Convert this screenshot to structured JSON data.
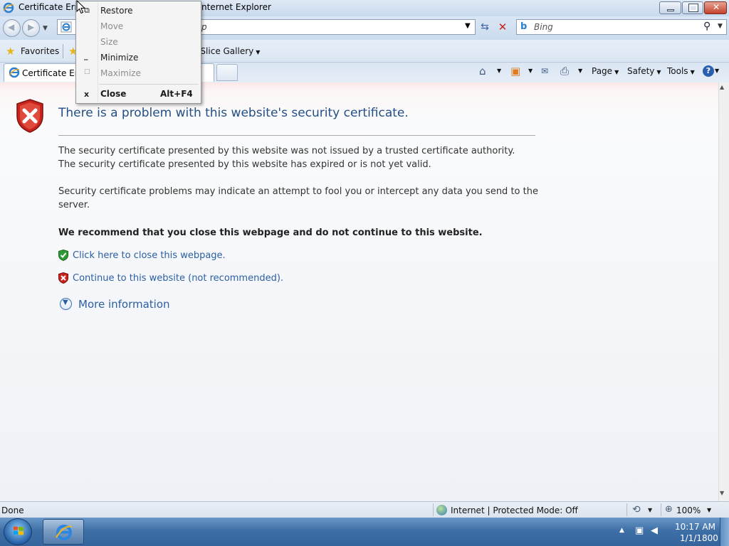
{
  "window": {
    "title_visible": "Certificate Erro",
    "title_tail": "nternet Explorer"
  },
  "navbar": {
    "address_text": "p",
    "search_placeholder": "Bing"
  },
  "favorites_bar": {
    "favorites_label": "Favorites",
    "gallery_label": "b Slice Gallery"
  },
  "tabs": {
    "active_title": "Certificate Erro"
  },
  "command_bar": {
    "page_label": "Page",
    "safety_label": "Safety",
    "tools_label": "Tools"
  },
  "page": {
    "heading": "There is a problem with this website's security certificate.",
    "para1_line1": "The security certificate presented by this website was not issued by a trusted certificate authority.",
    "para1_line2": "The security certificate presented by this website has expired or is not yet valid.",
    "para2_line1": "Security certificate problems may indicate an attempt to fool you or intercept any data you send to the",
    "para2_line2": "server.",
    "recommendation": "We recommend that you close this webpage and do not continue to this website.",
    "close_link": "Click here to close this webpage.",
    "continue_link": "Continue to this website (not recommended).",
    "more_info": "More information"
  },
  "status_bar": {
    "status": "Done",
    "zone": "Internet | Protected Mode: Off",
    "zoom": "100%"
  },
  "taskbar": {
    "time": "10:17 AM",
    "date": "1/1/1800"
  },
  "system_menu": {
    "items": [
      {
        "label": "Restore",
        "enabled": true
      },
      {
        "label": "Move",
        "enabled": false
      },
      {
        "label": "Size",
        "enabled": false
      },
      {
        "label": "Minimize",
        "enabled": true
      },
      {
        "label": "Maximize",
        "enabled": false
      },
      {
        "label": "Close",
        "enabled": true,
        "accelerator": "Alt+F4"
      }
    ]
  },
  "colors": {
    "link": "#2a5fa3",
    "heading": "#234f85",
    "error_red": "#c8231d"
  },
  "icons": {
    "title": "ie-icon",
    "error_shield": "red-shield-x-icon",
    "safe_shield": "green-shield-check-icon",
    "unsafe_shield": "red-shield-x-icon",
    "more": "chevron-down-circle-icon"
  }
}
